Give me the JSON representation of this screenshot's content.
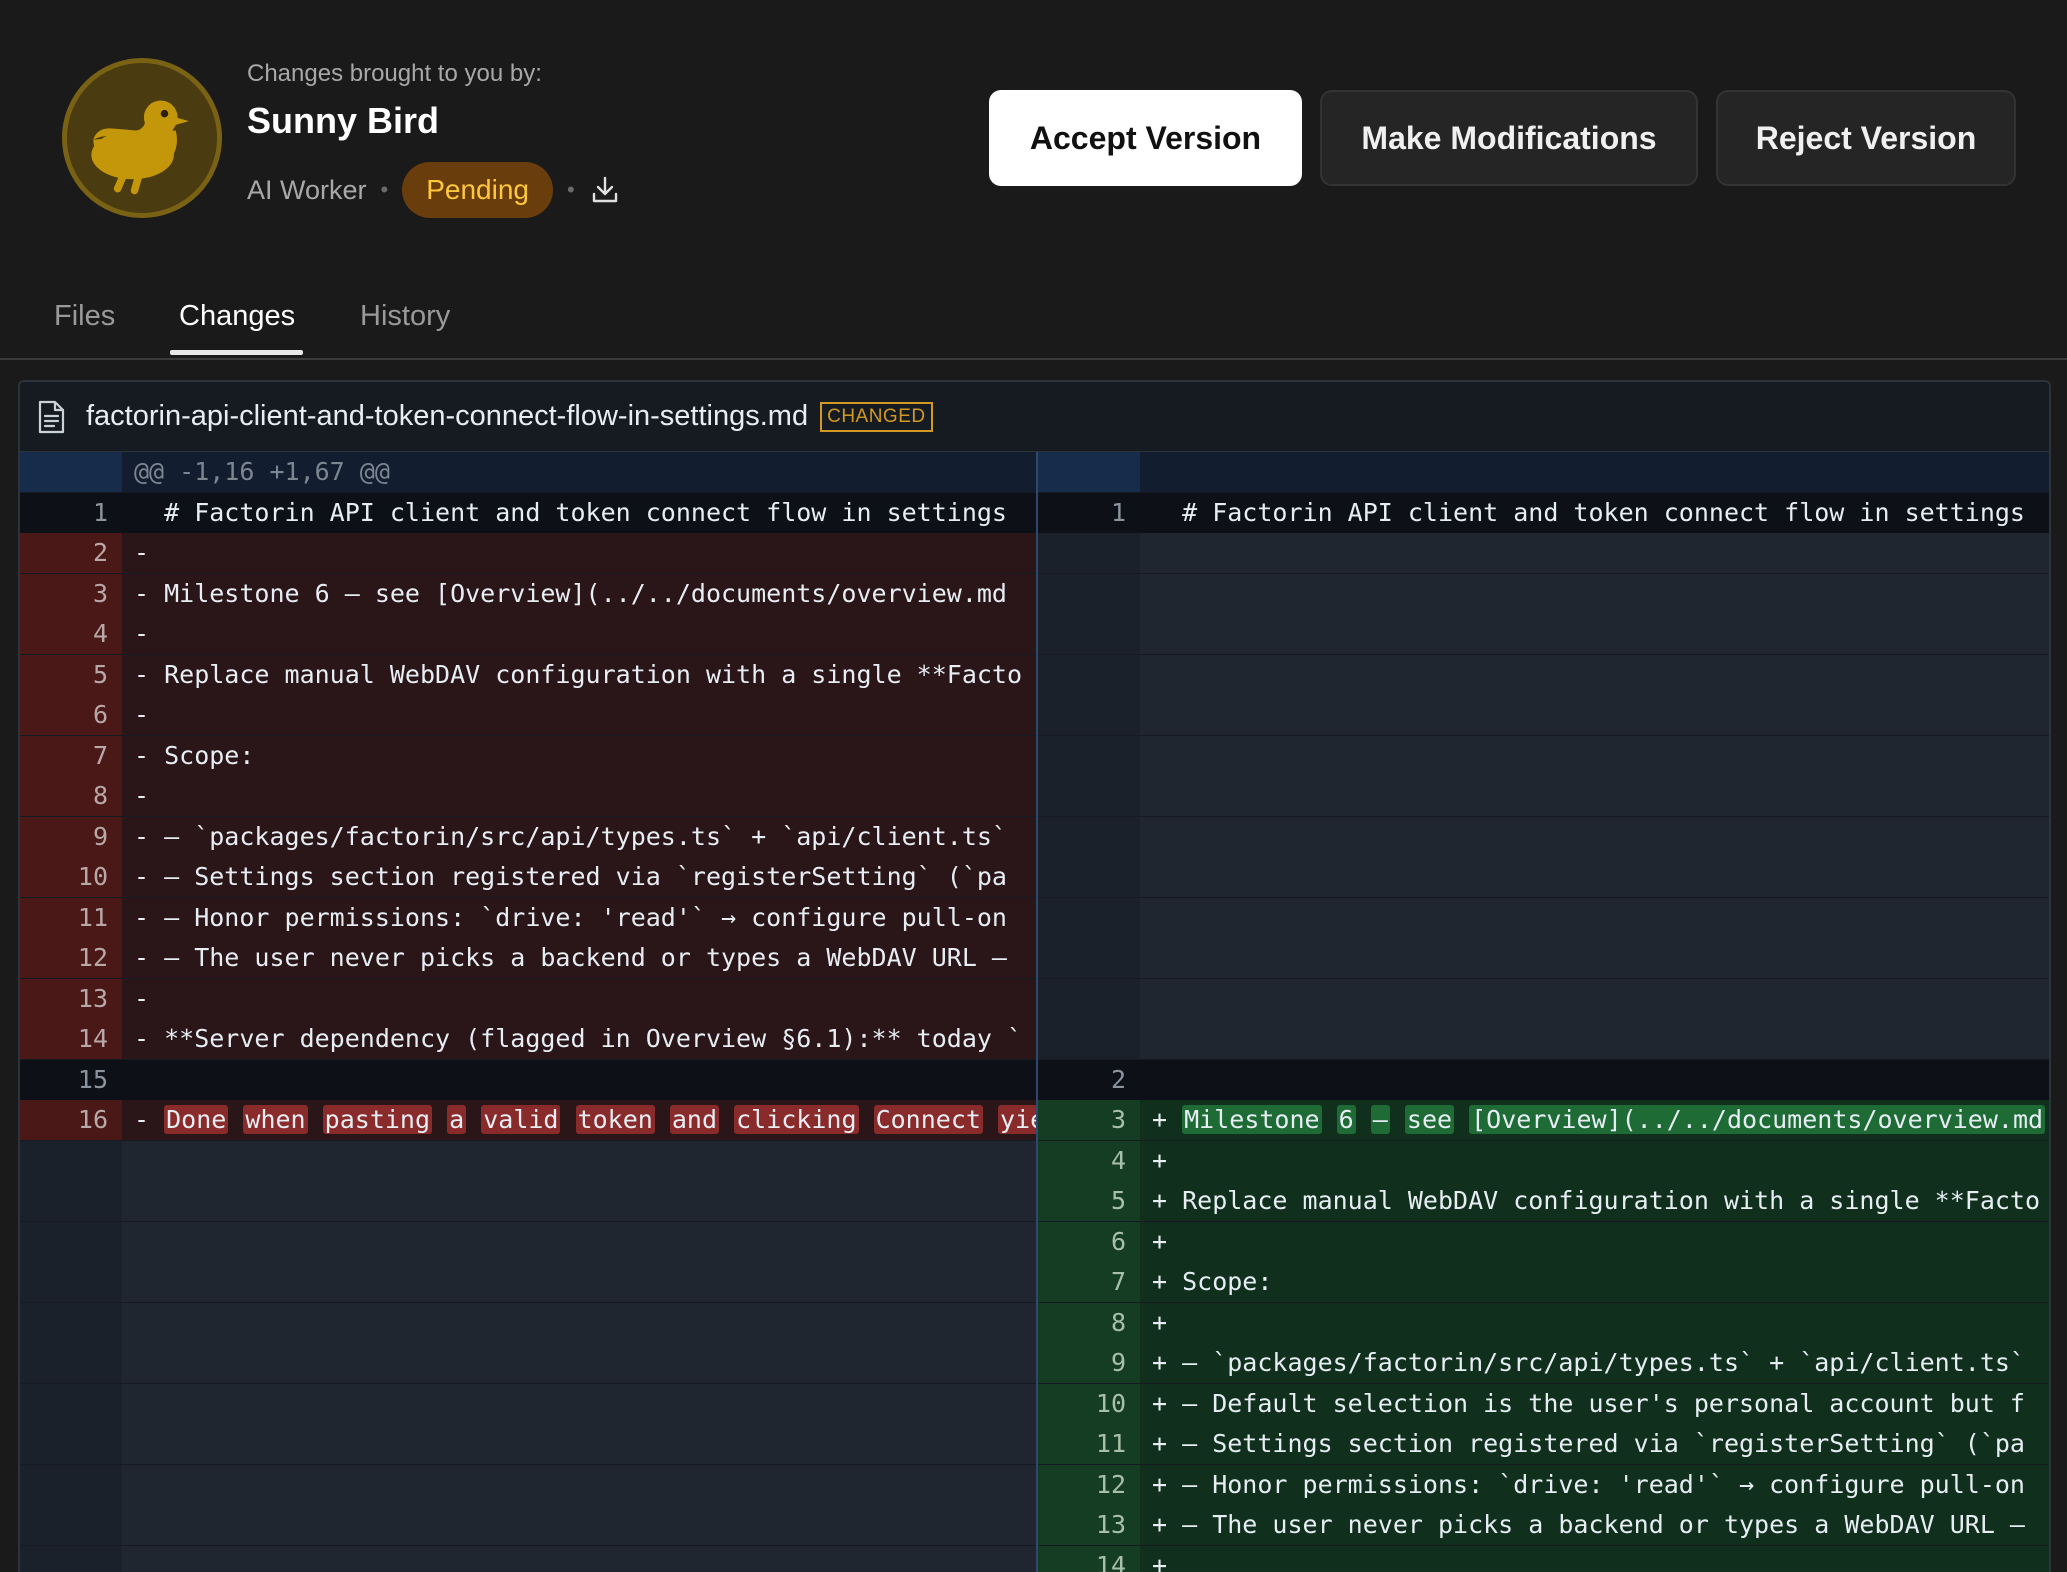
{
  "header": {
    "byline": "Changes brought to you by:",
    "author": "Sunny Bird",
    "role": "AI Worker",
    "status": "Pending",
    "status_color": "#ffc83a",
    "avatar_icon": "bird-icon",
    "download_icon": "download-icon"
  },
  "actions": {
    "accept": "Accept Version",
    "modify": "Make Modifications",
    "reject": "Reject Version"
  },
  "tabs": [
    {
      "label": "Files",
      "active": false
    },
    {
      "label": "Changes",
      "active": true
    },
    {
      "label": "History",
      "active": false
    }
  ],
  "file": {
    "name": "factorin-api-client-and-token-connect-flow-in-settings.md",
    "status": "CHANGED",
    "icon": "document-icon"
  },
  "diff": {
    "hunk": "@@ -1,16 +1,67 @@",
    "left_lines": [
      {
        "n": "1",
        "type": "ctx",
        "text": "  # Factorin API client and token connect flow in settings"
      },
      {
        "n": "2",
        "type": "del",
        "text": "-"
      },
      {
        "n": "3",
        "type": "del",
        "text": "- Milestone 6 — see [Overview](../../documents/overview.md"
      },
      {
        "n": "4",
        "type": "del",
        "text": "-"
      },
      {
        "n": "5",
        "type": "del",
        "text": "- Replace manual WebDAV configuration with a single **Facto"
      },
      {
        "n": "6",
        "type": "del",
        "text": "-"
      },
      {
        "n": "7",
        "type": "del",
        "text": "- Scope:"
      },
      {
        "n": "8",
        "type": "del",
        "text": "-"
      },
      {
        "n": "9",
        "type": "del",
        "text": "- – `packages/factorin/src/api/types.ts` + `api/client.ts`"
      },
      {
        "n": "10",
        "type": "del",
        "text": "- – Settings section registered via `registerSetting` (`pa"
      },
      {
        "n": "11",
        "type": "del",
        "text": "- – Honor permissions: `drive: 'read'` → configure pull-on"
      },
      {
        "n": "12",
        "type": "del",
        "text": "- – The user never picks a backend or types a WebDAV URL —"
      },
      {
        "n": "13",
        "type": "del",
        "text": "-"
      },
      {
        "n": "14",
        "type": "del",
        "text": "- **Server dependency (flagged in Overview §6.1):** today `"
      },
      {
        "n": "15",
        "type": "ctx",
        "text": ""
      },
      {
        "n": "16",
        "type": "del",
        "text": "- Done when pasting a valid token and clicking Connect yie",
        "words": [
          "Done",
          "when",
          "pasting",
          "a",
          "valid",
          "token",
          "and",
          "clicking",
          "Connect",
          "yie"
        ]
      }
    ],
    "right_lines": [
      {
        "n": "1",
        "type": "ctx",
        "text": "  # Factorin API client and token connect flow in settings"
      },
      {
        "n": "2",
        "type": "ctx",
        "text": ""
      },
      {
        "n": "3",
        "type": "add",
        "text": "+ Milestone 6 — see [Overview](../../documents/overview.md",
        "words": [
          "Milestone",
          "6",
          "—",
          "see",
          "[Overview](../../documents/overview.md"
        ]
      },
      {
        "n": "4",
        "type": "add",
        "text": "+"
      },
      {
        "n": "5",
        "type": "add",
        "text": "+ Replace manual WebDAV configuration with a single **Facto"
      },
      {
        "n": "6",
        "type": "add",
        "text": "+"
      },
      {
        "n": "7",
        "type": "add",
        "text": "+ Scope:"
      },
      {
        "n": "8",
        "type": "add",
        "text": "+"
      },
      {
        "n": "9",
        "type": "add",
        "text": "+ – `packages/factorin/src/api/types.ts` + `api/client.ts`"
      },
      {
        "n": "10",
        "type": "add",
        "text": "+ – Default selection is the user's personal account but f"
      },
      {
        "n": "11",
        "type": "add",
        "text": "+ – Settings section registered via `registerSetting` (`pa"
      },
      {
        "n": "12",
        "type": "add",
        "text": "+ – Honor permissions: `drive: 'read'` → configure pull-on"
      },
      {
        "n": "13",
        "type": "add",
        "text": "+ – The user never picks a backend or types a WebDAV URL —"
      },
      {
        "n": "14",
        "type": "add",
        "text": "+"
      }
    ]
  }
}
